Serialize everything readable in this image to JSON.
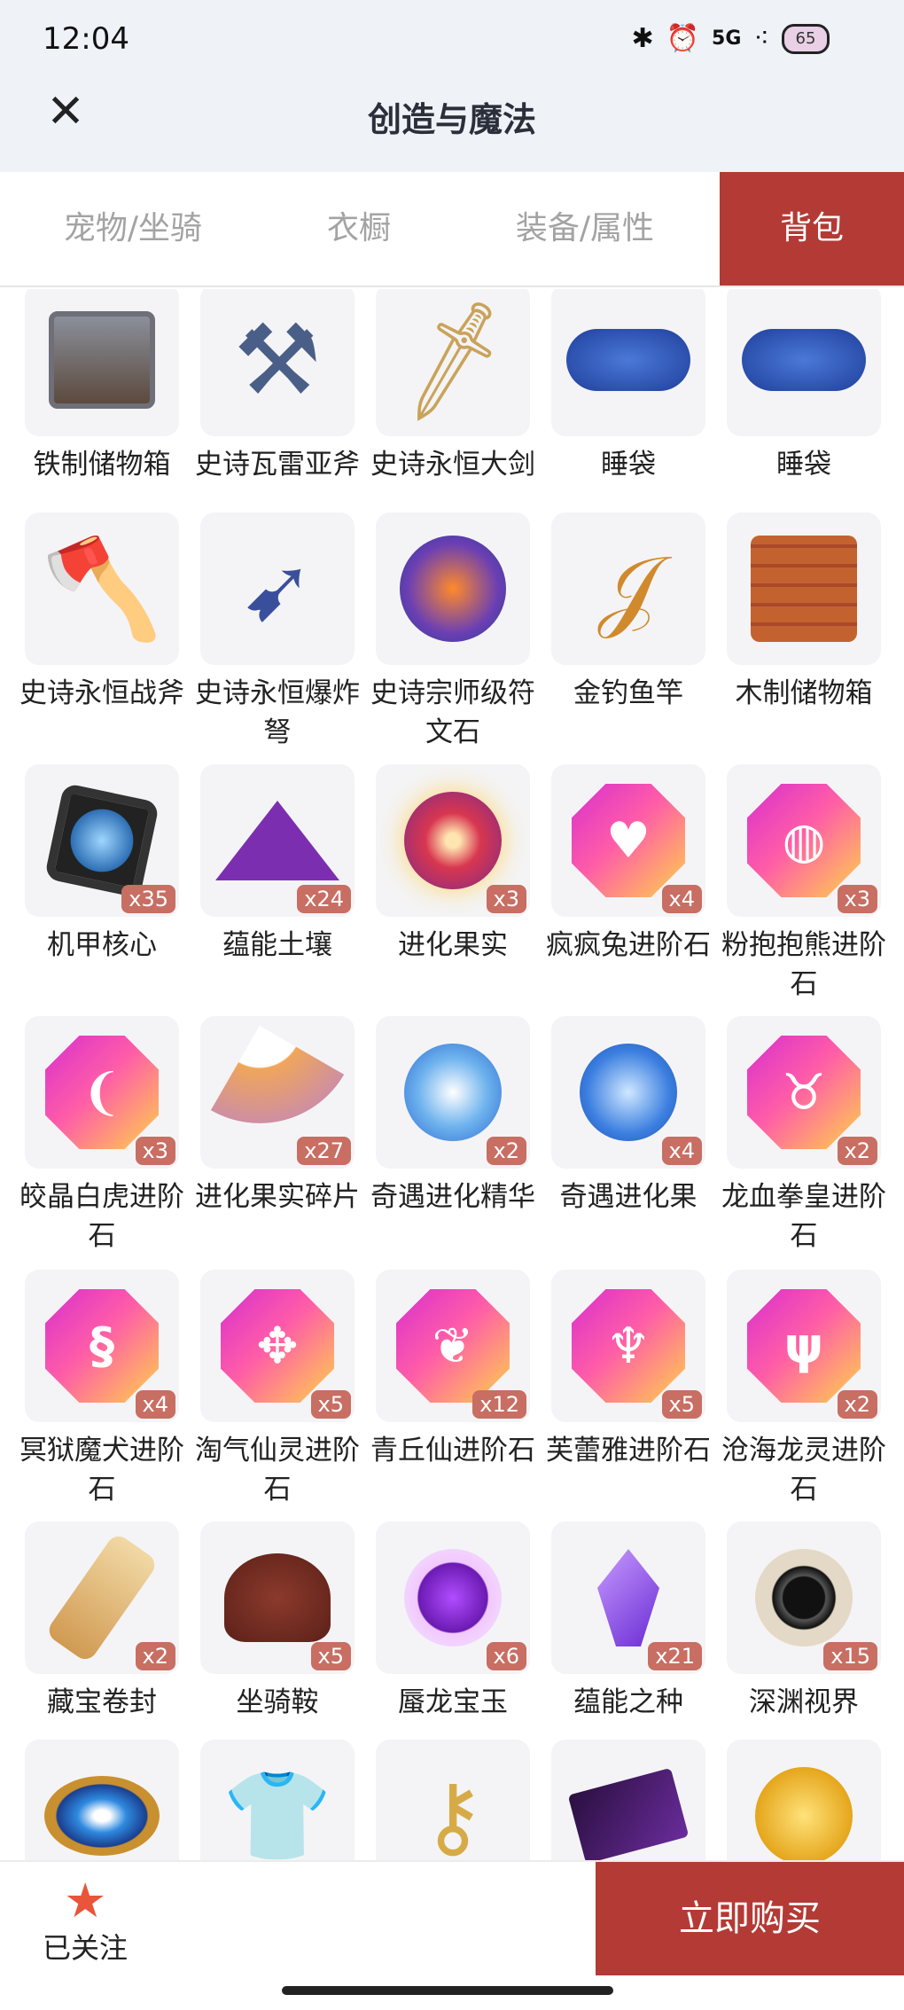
{
  "status_bar": {
    "time": "12:04",
    "network": "5G",
    "battery": "65"
  },
  "header": {
    "title": "创造与魔法"
  },
  "tabs": [
    {
      "label": "宠物/坐骑"
    },
    {
      "label": "衣橱"
    },
    {
      "label": "装备/属性"
    },
    {
      "label": "背包"
    }
  ],
  "items": [
    {
      "label": "铁制储物箱",
      "count": "",
      "icon": "iron-chest-icon"
    },
    {
      "label": "史诗瓦雷亚斧",
      "count": "",
      "icon": "epic-axe-icon"
    },
    {
      "label": "史诗永恒大剑",
      "count": "",
      "icon": "epic-greatsword-icon"
    },
    {
      "label": "睡袋",
      "count": "",
      "icon": "sleeping-bag-icon"
    },
    {
      "label": "睡袋",
      "count": "",
      "icon": "sleeping-bag-icon"
    },
    {
      "label": "史诗永恒战斧",
      "count": "",
      "icon": "epic-battleaxe-icon"
    },
    {
      "label": "史诗永恒爆炸弩",
      "count": "",
      "icon": "epic-crossbow-icon"
    },
    {
      "label": "史诗宗师级符文石",
      "count": "",
      "icon": "rune-stone-icon"
    },
    {
      "label": "金钓鱼竿",
      "count": "",
      "icon": "fishing-rod-icon"
    },
    {
      "label": "木制储物箱",
      "count": "",
      "icon": "wooden-chest-icon"
    },
    {
      "label": "机甲核心",
      "count": "x35",
      "icon": "mech-core-icon"
    },
    {
      "label": "蕴能土壤",
      "count": "x24",
      "icon": "soil-icon"
    },
    {
      "label": "进化果实",
      "count": "x3",
      "icon": "evolution-fruit-icon"
    },
    {
      "label": "疯疯兔进阶石",
      "count": "x4",
      "icon": "gem-rabbit-icon"
    },
    {
      "label": "粉抱抱熊进阶石",
      "count": "x3",
      "icon": "gem-egg-icon"
    },
    {
      "label": "皎晶白虎进阶石",
      "count": "x3",
      "icon": "gem-claw-icon"
    },
    {
      "label": "进化果实碎片",
      "count": "x27",
      "icon": "fruit-shard-icon"
    },
    {
      "label": "奇遇进化精华",
      "count": "x2",
      "icon": "adventure-essence-icon"
    },
    {
      "label": "奇遇进化果",
      "count": "x4",
      "icon": "adventure-fruit-icon"
    },
    {
      "label": "龙血拳皇进阶石",
      "count": "x2",
      "icon": "gem-bull-icon"
    },
    {
      "label": "冥狱魔犬进阶石",
      "count": "x4",
      "icon": "gem-wave-icon"
    },
    {
      "label": "淘气仙灵进阶石",
      "count": "x5",
      "icon": "gem-fairy-icon"
    },
    {
      "label": "青丘仙进阶石",
      "count": "x12",
      "icon": "gem-fox-icon"
    },
    {
      "label": "芙蕾雅进阶石",
      "count": "x5",
      "icon": "gem-wing-icon"
    },
    {
      "label": "沧海龙灵进阶石",
      "count": "x2",
      "icon": "gem-flame-icon"
    },
    {
      "label": "藏宝卷封",
      "count": "x2",
      "icon": "treasure-scroll-icon"
    },
    {
      "label": "坐骑鞍",
      "count": "x5",
      "icon": "saddle-icon"
    },
    {
      "label": "蜃龙宝玉",
      "count": "x6",
      "icon": "dragon-jade-icon"
    },
    {
      "label": "蕴能之种",
      "count": "x21",
      "icon": "crystal-seed-icon"
    },
    {
      "label": "深渊视界",
      "count": "x15",
      "icon": "abyss-vision-icon"
    },
    {
      "label": "",
      "count": "",
      "icon": "eye-crest-icon"
    },
    {
      "label": "",
      "count": "",
      "icon": "yellow-shirt-icon"
    },
    {
      "label": "",
      "count": "",
      "icon": "golden-key-icon"
    },
    {
      "label": "",
      "count": "",
      "icon": "dark-scroll-icon"
    },
    {
      "label": "",
      "count": "",
      "icon": "gold-coin-icon"
    }
  ],
  "bottom_bar": {
    "follow_label": "已关注",
    "buy_label": "立即购买"
  },
  "colors": {
    "accent": "#b43a35",
    "badge": "#c86e63",
    "header_bg": "#eff3f8"
  }
}
